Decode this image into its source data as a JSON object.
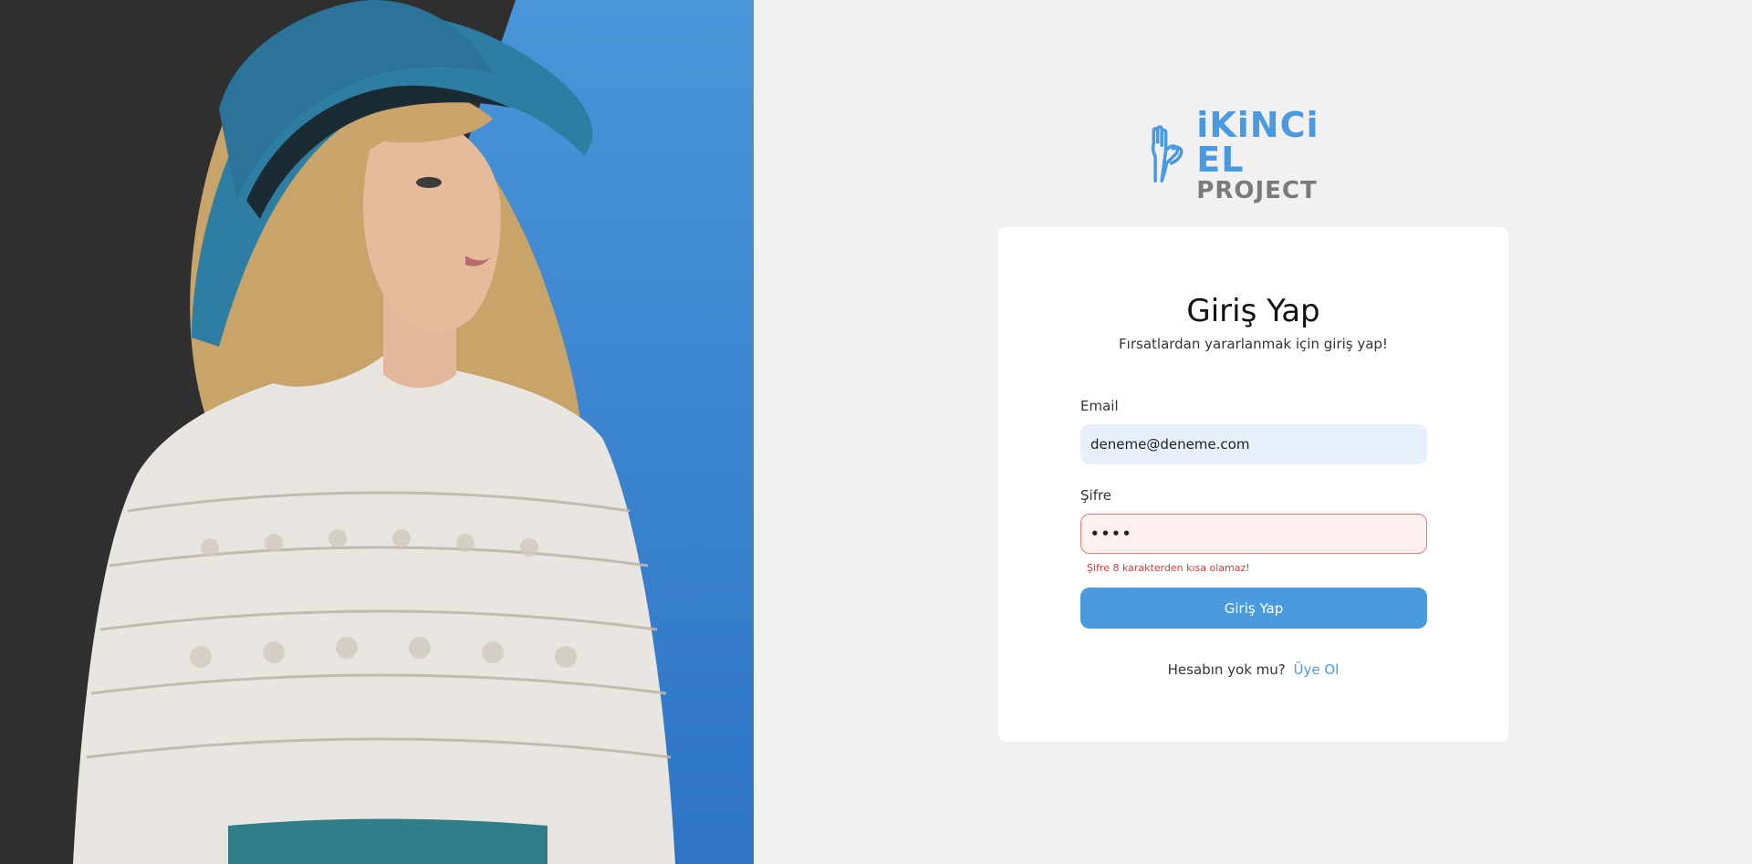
{
  "brand": {
    "logo_line1": "iKiNCi EL",
    "logo_line2": "PROJECT",
    "primary_color": "#4a9ae0",
    "secondary_text_color": "#7a7a7a"
  },
  "hero": {
    "background_left": "#2f2f2f",
    "background_right": "#3f88d6",
    "hat_color": "#2e7ea3"
  },
  "login": {
    "title": "Giriş Yap",
    "subtitle": "Fırsatlardan yararlanmak için giriş yap!",
    "email_label": "Email",
    "email_value": "deneme@deneme.com",
    "password_label": "Şifre",
    "password_value": "••••",
    "password_error": "Şifre 8 karakterden kısa olamaz!",
    "submit_label": "Giriş Yap",
    "signup_prompt": "Hesabın yok mu?",
    "signup_link": "Üye Ol"
  },
  "colors": {
    "page_bg": "#f1f1f1",
    "card_bg": "#ffffff",
    "error": "#d23c3c",
    "email_input_bg": "#e8f0fe",
    "password_input_bg": "#fff0f0"
  }
}
